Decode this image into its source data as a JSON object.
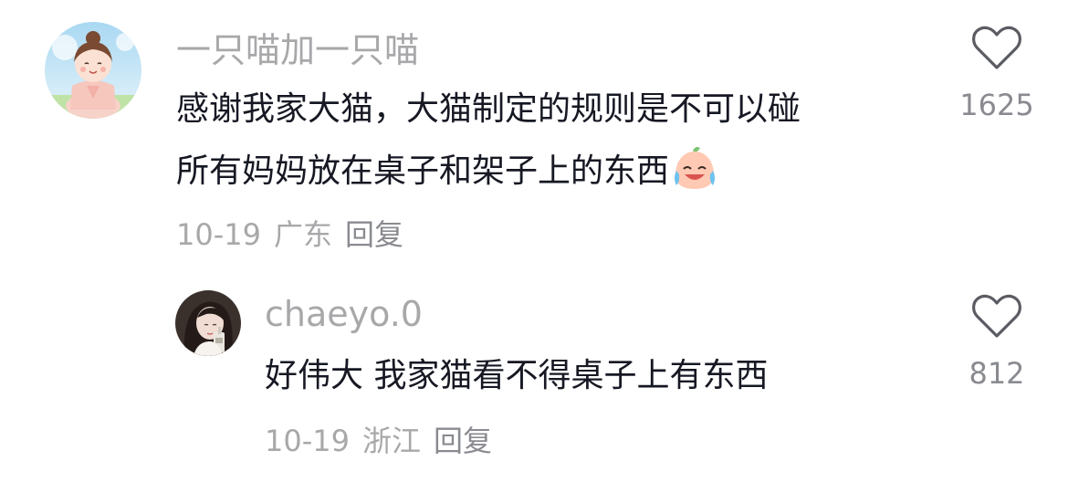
{
  "comments": [
    {
      "username": "一只喵加一只喵",
      "lines": [
        "感谢我家大猫，大猫制定的规则是不可以碰",
        "所有妈妈放在桌子和架子上的东西"
      ],
      "emoji": "crying-laughing-emoji",
      "date": "10-19",
      "location": "广东",
      "reply_label": "回复",
      "likes": "1625",
      "avatar": "cartoon-girl-avatar"
    },
    {
      "username": "chaeyo.0",
      "lines": [
        "好伟大 我家猫看不得桌子上有东西"
      ],
      "date": "10-19",
      "location": "浙江",
      "reply_label": "回复",
      "likes": "812",
      "avatar": "photo-avatar"
    }
  ],
  "icons": {
    "like": "heart-outline-icon"
  },
  "colors": {
    "text": "#161823",
    "muted": "#a8a8ab",
    "like_icon": "#5b5c63"
  }
}
